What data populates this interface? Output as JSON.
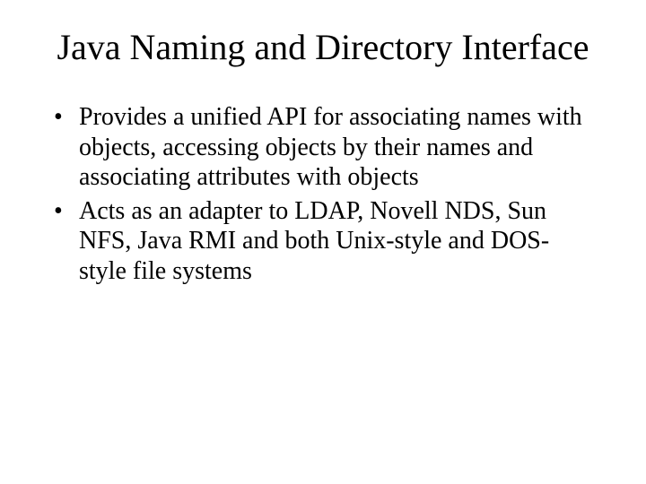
{
  "slide": {
    "title": "Java Naming and Directory Interface",
    "bullets": [
      "Provides a unified API for associating names with objects, accessing objects by their names and associating attributes with objects",
      "Acts as an adapter to LDAP, Novell NDS, Sun NFS, Java RMI and both Unix-style and DOS-style file systems"
    ]
  }
}
